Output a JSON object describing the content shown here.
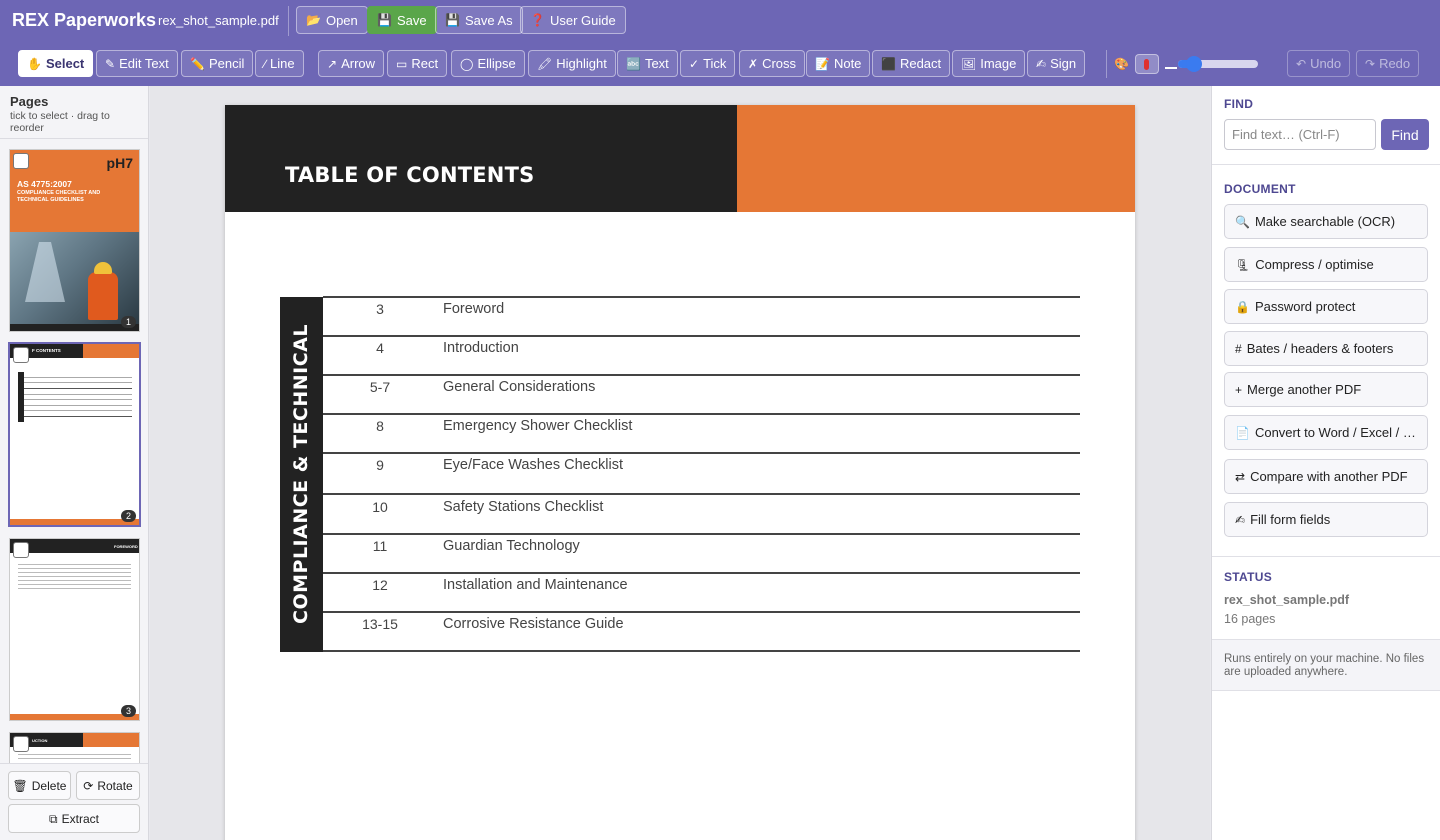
{
  "header": {
    "app_title": "REX Paperworks",
    "file_name": "rex_shot_sample.pdf",
    "buttons": [
      {
        "icon": "📂",
        "label": "Open"
      },
      {
        "icon": "💾",
        "label": "Save"
      },
      {
        "icon": "💾",
        "label": "Save As"
      },
      {
        "icon": "❓",
        "label": "User Guide"
      }
    ]
  },
  "toolbar": {
    "tools": [
      {
        "icon": "✋",
        "label": "Select"
      },
      {
        "icon": "✎",
        "label": "Edit Text"
      },
      {
        "icon": "✏️",
        "label": "Pencil"
      },
      {
        "icon": "∕",
        "label": "Line"
      },
      {
        "icon": "↗",
        "label": "Arrow"
      },
      {
        "icon": "▭",
        "label": "Rect"
      },
      {
        "icon": "◯",
        "label": "Ellipse"
      },
      {
        "icon": "🖍",
        "label": "Highlight"
      },
      {
        "icon": "🔤",
        "label": "Text"
      },
      {
        "icon": "✓",
        "label": "Tick"
      },
      {
        "icon": "✗",
        "label": "Cross"
      },
      {
        "icon": "📝",
        "label": "Note"
      },
      {
        "icon": "⬛",
        "label": "Redact"
      },
      {
        "icon": "🖼",
        "label": "Image"
      },
      {
        "icon": "✍",
        "label": "Sign"
      }
    ],
    "history": [
      {
        "icon": "↶",
        "label": "Undo"
      },
      {
        "icon": "↷",
        "label": "Redo"
      }
    ],
    "stroke_color": "#e0302e",
    "stroke_width_fraction": 0.12
  },
  "pages_panel": {
    "title": "Pages",
    "subtitle": "tick to select · drag to reorder",
    "thumbs": [
      {
        "page": "1",
        "title": "AS 4775:2007",
        "subtitle": "COMPLIANCE CHECKLIST AND TECHNICAL GUIDELINES",
        "logo": "pH7"
      },
      {
        "page": "2",
        "title": "F CONTENTS"
      },
      {
        "page": "3",
        "title": "FOREWORD"
      },
      {
        "page": "",
        "title": "UCTION"
      }
    ],
    "buttons": [
      {
        "icon": "🗑",
        "label": "Delete"
      },
      {
        "icon": "⟳",
        "label": "Rotate"
      },
      {
        "icon": "⧉",
        "label": "Extract"
      }
    ]
  },
  "document": {
    "page_title": "TABLE OF CONTENTS",
    "side_label": "COMPLIANCE & TECHNICAL",
    "entries": [
      {
        "page": "3",
        "title": "Foreword"
      },
      {
        "page": "4",
        "title": "Introduction"
      },
      {
        "page": "5-7",
        "title": "General Considerations"
      },
      {
        "page": "8",
        "title": "Emergency Shower Checklist"
      },
      {
        "page": "9",
        "title": "Eye/Face Washes Checklist"
      },
      {
        "page": "10",
        "title": "Safety Stations Checklist"
      },
      {
        "page": "11",
        "title": "Guardian Technology"
      },
      {
        "page": "12",
        "title": "Installation and Maintenance"
      },
      {
        "page": "13-15",
        "title": "Corrosive Resistance Guide"
      }
    ]
  },
  "right_panel": {
    "find_heading": "FIND",
    "find_placeholder": "Find text… (Ctrl-F)",
    "find_button": "Find",
    "document_heading": "DOCUMENT",
    "actions": [
      {
        "icon": "🔍",
        "label": "Make searchable (OCR)"
      },
      {
        "icon": "🗜",
        "label": "Compress / optimise"
      },
      {
        "icon": "🔒",
        "label": "Password protect"
      },
      {
        "icon": "#",
        "label": "Bates / headers & footers"
      },
      {
        "icon": "+",
        "label": "Merge another PDF"
      },
      {
        "icon": "📄",
        "label": "Convert to Word / Excel / …"
      },
      {
        "icon": "⇄",
        "label": "Compare with another PDF"
      },
      {
        "icon": "✍",
        "label": "Fill form fields"
      }
    ],
    "status_heading": "STATUS",
    "status_file": "rex_shot_sample.pdf",
    "status_pages": "16 pages",
    "note": "Runs entirely on your machine. No files are uploaded anywhere."
  },
  "colors": {
    "brand": "#6d66b5",
    "save_green": "#5aa64a",
    "doc_orange": "#e57735",
    "doc_dark": "#222222"
  }
}
